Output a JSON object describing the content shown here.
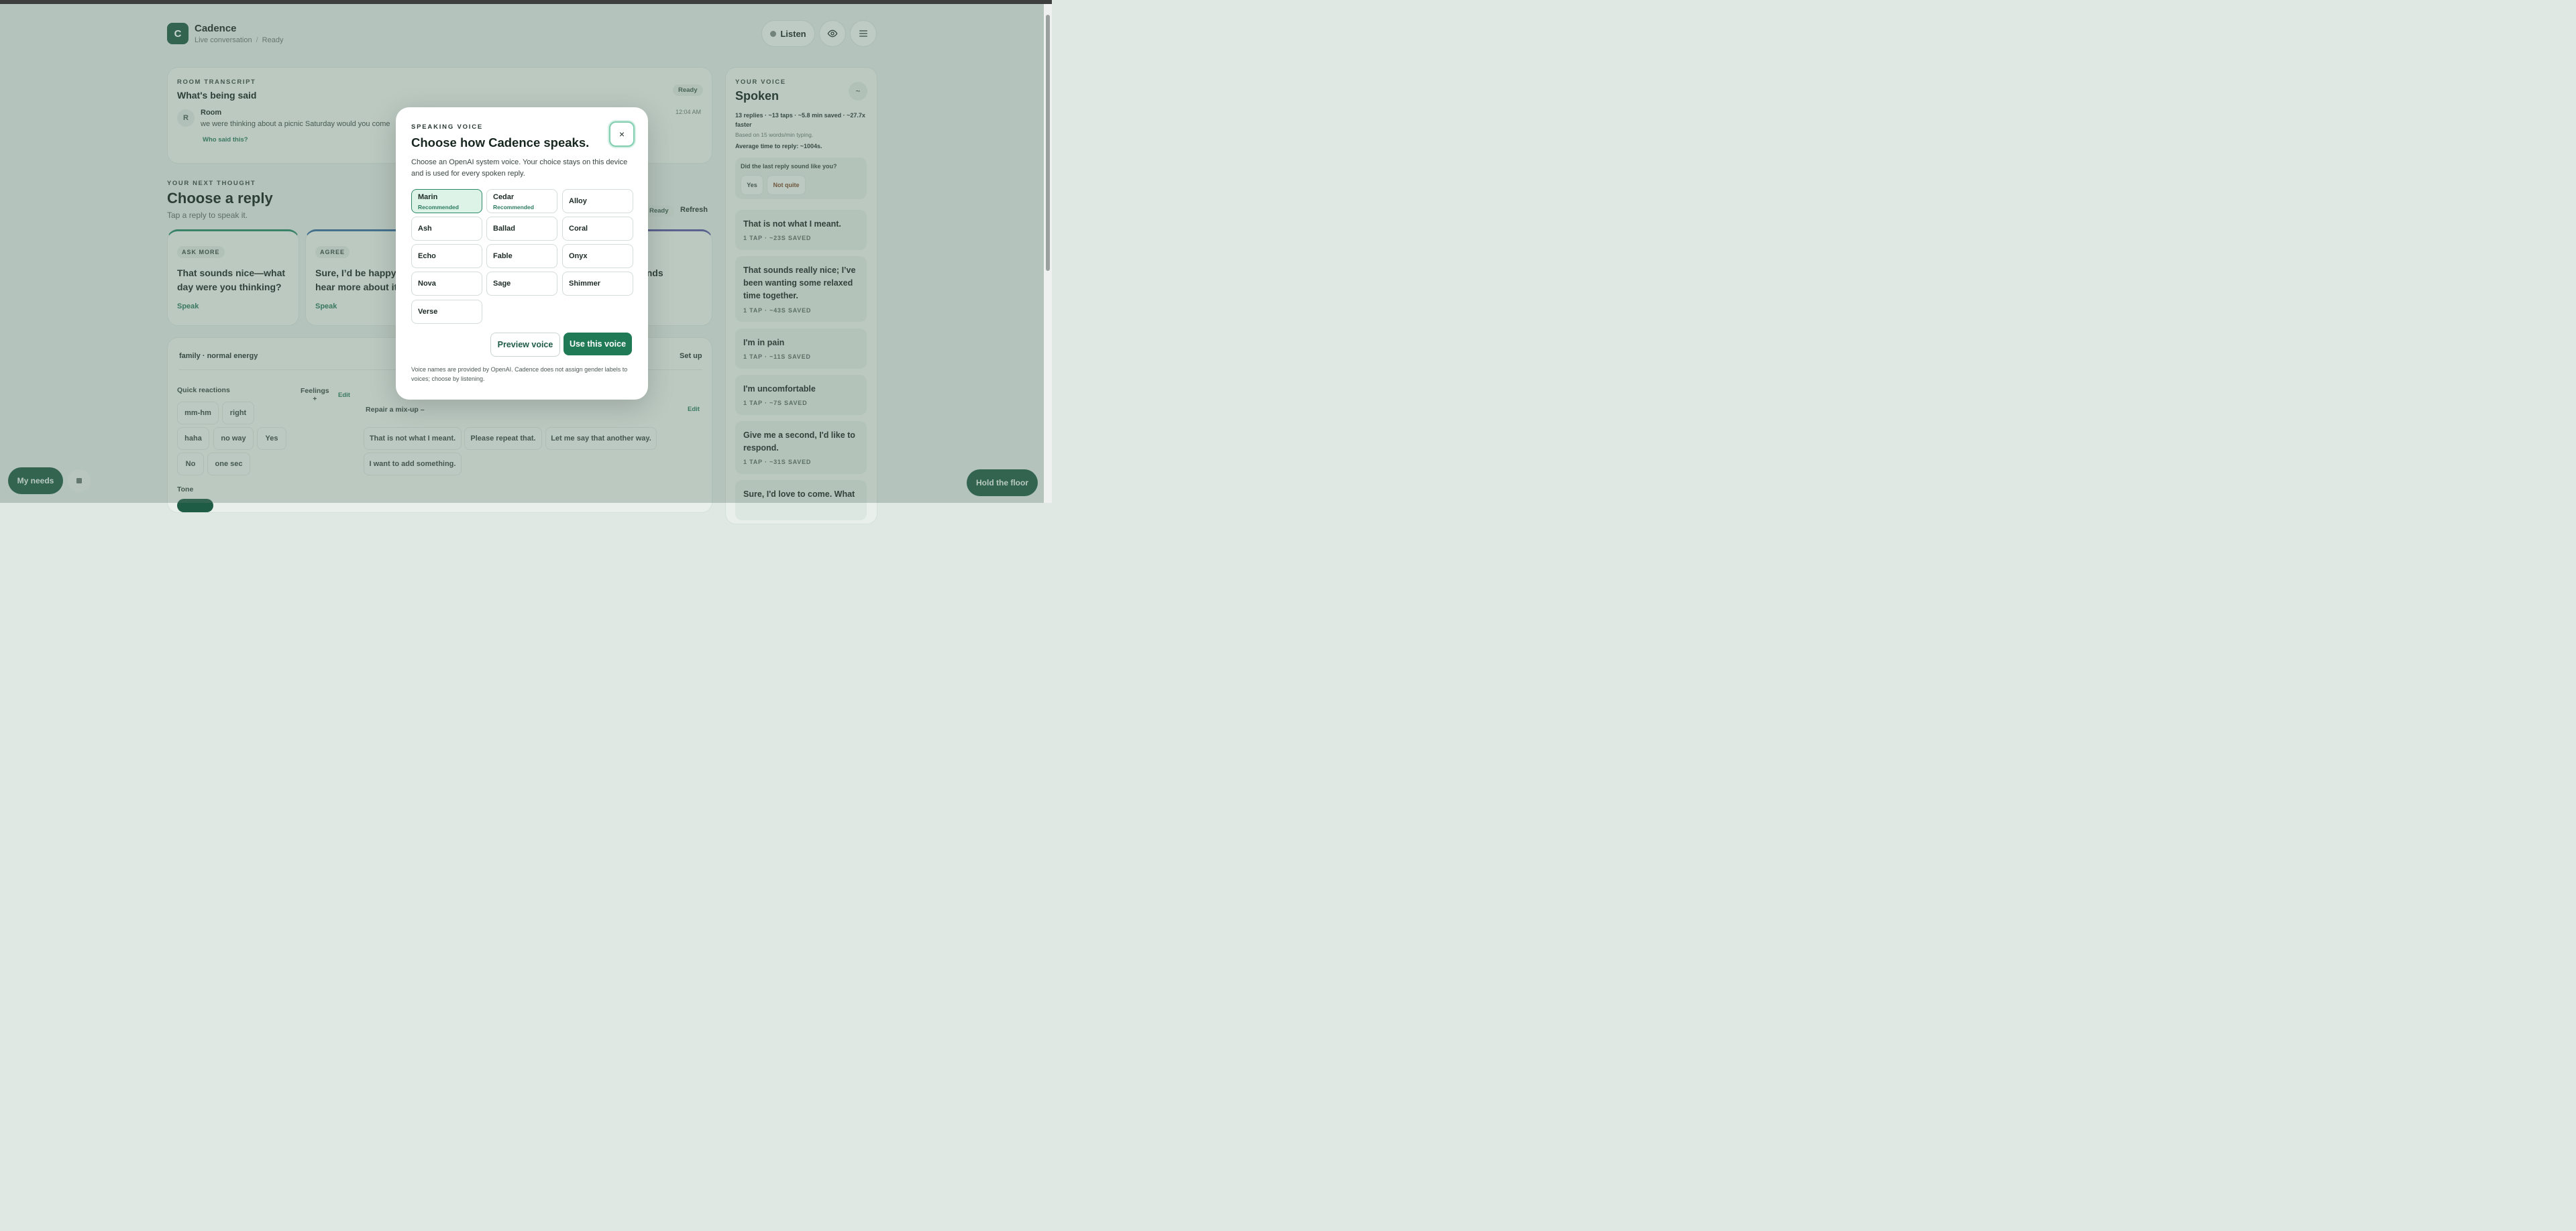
{
  "header": {
    "logo_letter": "C",
    "app_title": "Cadence",
    "breadcrumb": [
      "Live conversation",
      "Ready"
    ],
    "listen_label": "Listen"
  },
  "transcript": {
    "eyebrow": "ROOM TRANSCRIPT",
    "title": "What's being said",
    "status": "Ready",
    "avatar": "R",
    "speaker": "Room",
    "message": "we were thinking about a picnic Saturday would you come",
    "time": "12:04 AM",
    "who_link": "Who said this?"
  },
  "next": {
    "eyebrow": "YOUR NEXT THOUGHT",
    "title": "Choose a reply",
    "subtitle": "Tap a reply to speak it.",
    "status": "Ready",
    "refresh": "Refresh",
    "cards": [
      {
        "tag": "ASK MORE",
        "text": "That sounds nice—what day were you thinking?",
        "speak": "Speak"
      },
      {
        "tag": "AGREE",
        "text": "Sure, I’d be happy to hear more about it.",
        "speak": "Speak"
      },
      {
        "text": "A picnic sounds"
      }
    ]
  },
  "setup": {
    "context": "family · normal energy",
    "setup_link": "Set up",
    "quick_reactions_label": "Quick reactions",
    "quick_reactions": [
      "mm-hm",
      "right",
      "haha",
      "no way",
      "Yes",
      "No",
      "one sec"
    ],
    "feelings_label": "Feelings",
    "feelings_plus": "+",
    "feelings_edit": "Edit",
    "repair_label": "Repair a mix-up –",
    "repair_edit": "Edit",
    "repair_phrases": [
      "That is not what I meant.",
      "Please repeat that.",
      "Let me say that another way.",
      "I want to add something."
    ],
    "tone_label": "Tone"
  },
  "sidebar": {
    "eyebrow": "YOUR VOICE",
    "title": "Spoken",
    "toggle": "~",
    "stats": "13 replies · ~13 taps · ~5.8 min saved · ~27.7x faster",
    "basis": "Based on 15 words/min typing.",
    "avg": "Average time to reply: ~1004s.",
    "question": "Did the last reply sound like you?",
    "yes": "Yes",
    "not_quite": "Not quite",
    "replies": [
      {
        "text": "That is not what I meant.",
        "meta": "1 TAP · ~23S SAVED"
      },
      {
        "text": "That sounds really nice; I’ve been wanting some relaxed time together.",
        "meta": "1 TAP · ~43S SAVED"
      },
      {
        "text": "I'm in pain",
        "meta": "1 TAP · ~11S SAVED"
      },
      {
        "text": "I'm uncomfortable",
        "meta": "1 TAP · ~7S SAVED"
      },
      {
        "text": "Give me a second, I'd like to respond.",
        "meta": "1 TAP · ~31S SAVED"
      },
      {
        "text": "Sure, I'd love to come. What"
      }
    ]
  },
  "fabs": {
    "needs": "My needs",
    "hold": "Hold the floor"
  },
  "modal": {
    "eyebrow": "SPEAKING VOICE",
    "title": "Choose how Cadence speaks.",
    "close": "×",
    "description": "Choose an OpenAI system voice. Your choice stays on this device and is used for every spoken reply.",
    "voices": [
      {
        "name": "Marin",
        "note": "Recommended",
        "selected": true
      },
      {
        "name": "Cedar",
        "note": "Recommended"
      },
      {
        "name": "Alloy"
      },
      {
        "name": "Ash"
      },
      {
        "name": "Ballad"
      },
      {
        "name": "Coral"
      },
      {
        "name": "Echo"
      },
      {
        "name": "Fable"
      },
      {
        "name": "Onyx"
      },
      {
        "name": "Nova"
      },
      {
        "name": "Sage"
      },
      {
        "name": "Shimmer"
      },
      {
        "name": "Verse"
      }
    ],
    "preview_label": "Preview voice",
    "use_label": "Use this voice",
    "footnote": "Voice names are provided by OpenAI. Cadence does not assign gender labels to voices; choose by listening."
  },
  "colors": {
    "brand": "#1f5c46",
    "accent": "#1f7a55",
    "selected_voice": "#ddf3e8"
  }
}
